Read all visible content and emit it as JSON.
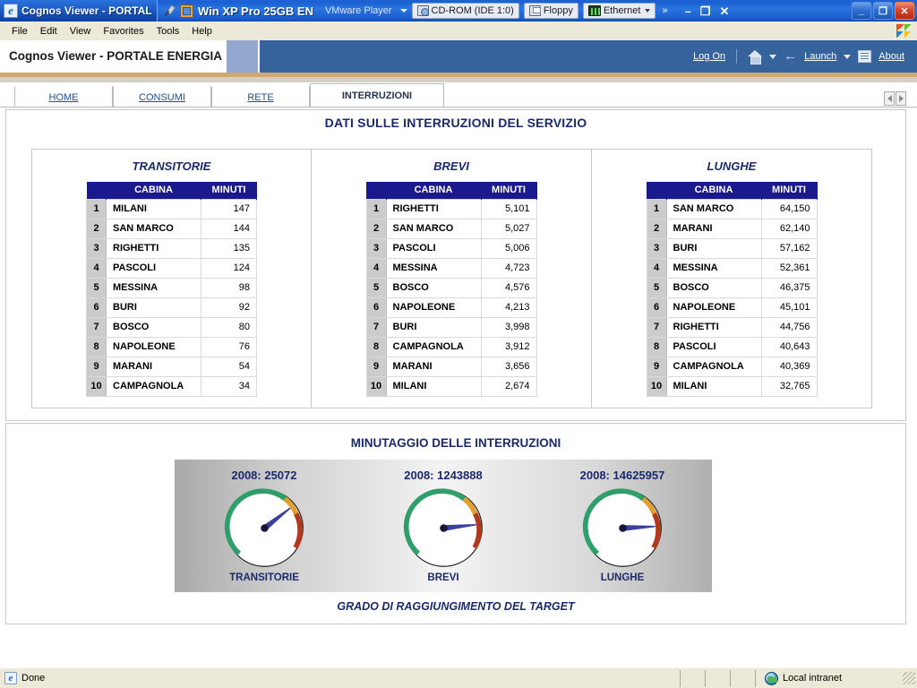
{
  "window": {
    "ie_tab_title": "Cognos Viewer - PORTAL",
    "vm_name": "Win XP Pro 25GB EN",
    "vm_player_label": "VMware Player",
    "devices": [
      {
        "label": "CD-ROM (IDE 1:0)",
        "icon": "cdrom-icon"
      },
      {
        "label": "Floppy",
        "icon": "floppy-icon"
      },
      {
        "label": "Ethernet",
        "icon": "ethernet-icon"
      }
    ],
    "overflow_glyph": "»",
    "vm_minimize": "–",
    "vm_restore": "❐",
    "vm_close": "✕",
    "win_minimize": "_",
    "win_restore": "❐",
    "win_close": "✕"
  },
  "menubar": {
    "items": [
      "File",
      "Edit",
      "View",
      "Favorites",
      "Tools",
      "Help"
    ]
  },
  "app_header": {
    "title": "Cognos Viewer - PORTALE ENERGIA",
    "log_on": "Log On",
    "launch": "Launch",
    "about": "About"
  },
  "tabs": [
    {
      "label": "HOME",
      "active": false
    },
    {
      "label": "CONSUMI",
      "active": false
    },
    {
      "label": "RETE",
      "active": false
    },
    {
      "label": "INTERRUZIONI",
      "active": true
    }
  ],
  "report": {
    "title": "DATI SULLE INTERRUZIONI DEL SERVIZIO",
    "columns": {
      "index": "",
      "cabina": "CABINA",
      "minuti": "MINUTI"
    },
    "tables": [
      {
        "caption": "TRANSITORIE",
        "rows": [
          {
            "idx": "1",
            "cabina": "MILANI",
            "minuti": "147"
          },
          {
            "idx": "2",
            "cabina": "SAN MARCO",
            "minuti": "144"
          },
          {
            "idx": "3",
            "cabina": "RIGHETTI",
            "minuti": "135"
          },
          {
            "idx": "4",
            "cabina": "PASCOLI",
            "minuti": "124"
          },
          {
            "idx": "5",
            "cabina": "MESSINA",
            "minuti": "98"
          },
          {
            "idx": "6",
            "cabina": "BURI",
            "minuti": "92"
          },
          {
            "idx": "7",
            "cabina": "BOSCO",
            "minuti": "80"
          },
          {
            "idx": "8",
            "cabina": "NAPOLEONE",
            "minuti": "76"
          },
          {
            "idx": "9",
            "cabina": "MARANI",
            "minuti": "54"
          },
          {
            "idx": "10",
            "cabina": "CAMPAGNOLA",
            "minuti": "34"
          }
        ]
      },
      {
        "caption": "BREVI",
        "rows": [
          {
            "idx": "1",
            "cabina": "RIGHETTI",
            "minuti": "5,101"
          },
          {
            "idx": "2",
            "cabina": "SAN MARCO",
            "minuti": "5,027"
          },
          {
            "idx": "3",
            "cabina": "PASCOLI",
            "minuti": "5,006"
          },
          {
            "idx": "4",
            "cabina": "MESSINA",
            "minuti": "4,723"
          },
          {
            "idx": "5",
            "cabina": "BOSCO",
            "minuti": "4,576"
          },
          {
            "idx": "6",
            "cabina": "NAPOLEONE",
            "minuti": "4,213"
          },
          {
            "idx": "7",
            "cabina": "BURI",
            "minuti": "3,998"
          },
          {
            "idx": "8",
            "cabina": "CAMPAGNOLA",
            "minuti": "3,912"
          },
          {
            "idx": "9",
            "cabina": "MARANI",
            "minuti": "3,656"
          },
          {
            "idx": "10",
            "cabina": "MILANI",
            "minuti": "2,674"
          }
        ]
      },
      {
        "caption": "LUNGHE",
        "rows": [
          {
            "idx": "1",
            "cabina": "SAN MARCO",
            "minuti": "64,150"
          },
          {
            "idx": "2",
            "cabina": "MARANI",
            "minuti": "62,140"
          },
          {
            "idx": "3",
            "cabina": "BURI",
            "minuti": "57,162"
          },
          {
            "idx": "4",
            "cabina": "MESSINA",
            "minuti": "52,361"
          },
          {
            "idx": "5",
            "cabina": "BOSCO",
            "minuti": "46,375"
          },
          {
            "idx": "6",
            "cabina": "NAPOLEONE",
            "minuti": "45,101"
          },
          {
            "idx": "7",
            "cabina": "RIGHETTI",
            "minuti": "44,756"
          },
          {
            "idx": "8",
            "cabina": "PASCOLI",
            "minuti": "40,643"
          },
          {
            "idx": "9",
            "cabina": "CAMPAGNOLA",
            "minuti": "40,369"
          },
          {
            "idx": "10",
            "cabina": "MILANI",
            "minuti": "32,765"
          }
        ]
      }
    ]
  },
  "gauges_section": {
    "title": "MINUTAGGIO DELLE INTERRUZIONI",
    "footer": "GRADO DI RAGGIUNGIMENTO DEL TARGET"
  },
  "chart_data": {
    "type": "gauge",
    "title": "MINUTAGGIO DELLE INTERRUZIONI",
    "subtitle": "GRADO DI RAGGIUNGIMENTO DEL TARGET",
    "gauges": [
      {
        "label": "TRANSITORIE",
        "value_text": "2008: 25072",
        "value": 25072,
        "needle_deg": -38
      },
      {
        "label": "BREVI",
        "value_text": "2008: 1243888",
        "value": 1243888,
        "needle_deg": -6
      },
      {
        "label": "LUNGHE",
        "value_text": "2008: 14625957",
        "value": 14625957,
        "needle_deg": -3
      }
    ],
    "bands": [
      {
        "name": "green",
        "color": "#2e9e6b",
        "start_deg": 215,
        "end_deg": 55
      },
      {
        "name": "orange",
        "color": "#e0a030",
        "start_deg": 55,
        "end_deg": 108
      },
      {
        "name": "red",
        "color": "#b03a1e",
        "start_deg": 108,
        "end_deg": 130
      }
    ],
    "needle_color": "#3b3f9e"
  },
  "colors": {
    "header_blue": "#36639c",
    "header_blue_light": "#92a8ce",
    "header_rule": "#cfa972",
    "table_header": "#1a1a8c",
    "navy_text": "#1b2a6b",
    "link_blue": "#1d4f91",
    "gauge_green": "#2e9e6b",
    "gauge_orange": "#e0a030",
    "gauge_red": "#b03a1e",
    "needle": "#3b3f9e"
  },
  "statusbar": {
    "status": "Done",
    "zone": "Local intranet"
  }
}
